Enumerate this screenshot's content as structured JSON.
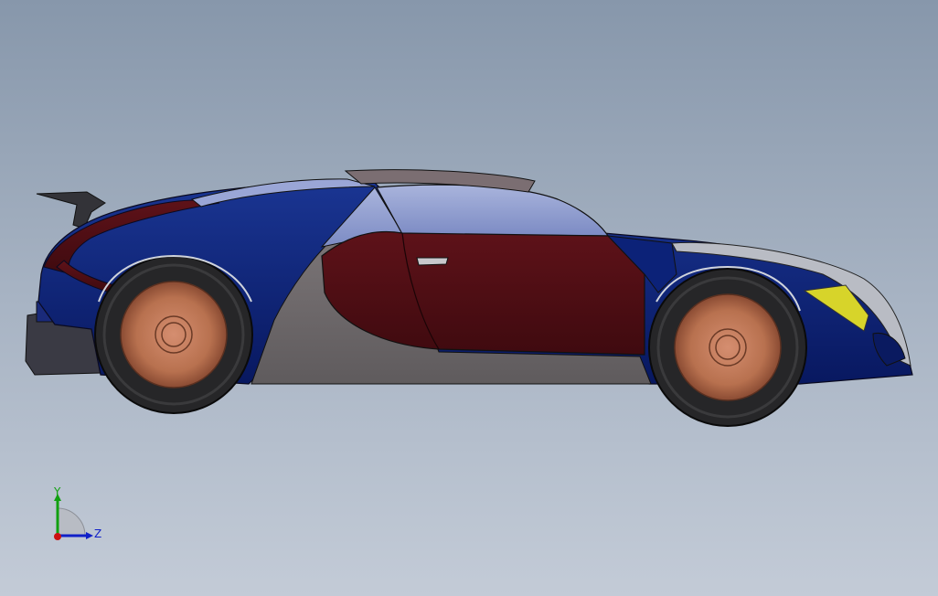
{
  "viewport": {
    "background_top": "#8797ab",
    "background_bottom": "#c3cbd7"
  },
  "model": {
    "colors": {
      "body_blue": "#0b1f73",
      "body_maroon": "#4f0e14",
      "glass": "#8a98cc",
      "lower_panel": "#6e6a6c",
      "rim": "#c07a5e",
      "tire": "#262628",
      "headlight": "#d7d42a",
      "grey_trim": "#b9bcc4"
    }
  },
  "triad": {
    "x_color": "#cc1010",
    "y_color": "#11a011",
    "z_color": "#1020c8",
    "y_label": "Y",
    "z_label": "Z"
  }
}
